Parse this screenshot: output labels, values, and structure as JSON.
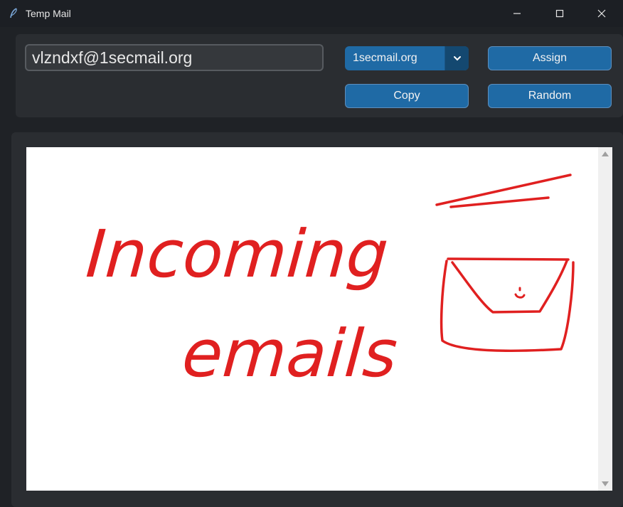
{
  "window": {
    "title": "Temp Mail",
    "icon": "feather-icon"
  },
  "controls": {
    "email_value": "vlzndxf@1secmail.org",
    "domain_selected": "1secmail.org",
    "assign_label": "Assign",
    "copy_label": "Copy",
    "random_label": "Random"
  },
  "inbox": {
    "drawing_text_line1": "Incoming",
    "drawing_text_line2": "emails"
  },
  "colors": {
    "accent": "#1f6aa5",
    "accent_dark": "#144870",
    "ink": "#e02020",
    "panel": "#2a2d31",
    "background": "#1f2226"
  }
}
